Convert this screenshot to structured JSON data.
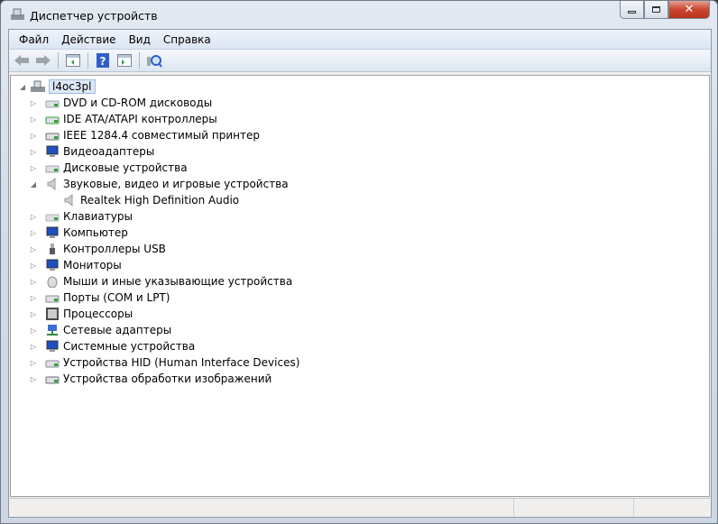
{
  "window": {
    "title": "Диспетчер устройств"
  },
  "menu": [
    "Файл",
    "Действие",
    "Вид",
    "Справка"
  ],
  "toolbar": [
    "back",
    "forward",
    "show-hide-console-tree",
    "help",
    "properties",
    "scan-hardware"
  ],
  "tree": {
    "root": "l4oc3pl",
    "items": [
      {
        "label": "DVD и CD-ROM дисководы",
        "icon": "dvd-drive-icon",
        "color": "#9aa4ae"
      },
      {
        "label": "IDE ATA/ATAPI контроллеры",
        "icon": "ide-controller-icon",
        "color": "#3a9a3a"
      },
      {
        "label": "IEEE 1284.4 совместимый принтер",
        "icon": "printer-icon",
        "color": "#6b6f75"
      },
      {
        "label": "Видеоадаптеры",
        "icon": "display-adapter-icon",
        "color": "#1d4fc0"
      },
      {
        "label": "Дисковые устройства",
        "icon": "disk-drive-icon",
        "color": "#9aa4ae"
      },
      {
        "label": "Звуковые, видео и игровые устройства",
        "icon": "speaker-icon",
        "color": "#9a9a9a",
        "expanded": true,
        "children": [
          {
            "label": "Realtek High Definition Audio",
            "icon": "speaker-icon",
            "color": "#9a9a9a"
          }
        ]
      },
      {
        "label": "Клавиатуры",
        "icon": "keyboard-icon",
        "color": "#b0b4b8"
      },
      {
        "label": "Компьютер",
        "icon": "computer-icon",
        "color": "#1d4fc0"
      },
      {
        "label": "Контроллеры USB",
        "icon": "usb-icon",
        "color": "#555a60"
      },
      {
        "label": "Мониторы",
        "icon": "monitor-icon",
        "color": "#1d4fc0"
      },
      {
        "label": "Мыши и иные указывающие устройства",
        "icon": "mouse-icon",
        "color": "#8a8f95"
      },
      {
        "label": "Порты (COM и LPT)",
        "icon": "port-icon",
        "color": "#8a8f95"
      },
      {
        "label": "Процессоры",
        "icon": "processor-icon",
        "color": "#4a4a4a"
      },
      {
        "label": "Сетевые адаптеры",
        "icon": "network-adapter-icon",
        "color": "#2a8a3a"
      },
      {
        "label": "Системные устройства",
        "icon": "system-devices-icon",
        "color": "#1d4fc0"
      },
      {
        "label": "Устройства HID (Human Interface Devices)",
        "icon": "hid-icon",
        "color": "#8a8f95"
      },
      {
        "label": "Устройства обработки изображений",
        "icon": "imaging-device-icon",
        "color": "#6b6f75"
      }
    ]
  }
}
